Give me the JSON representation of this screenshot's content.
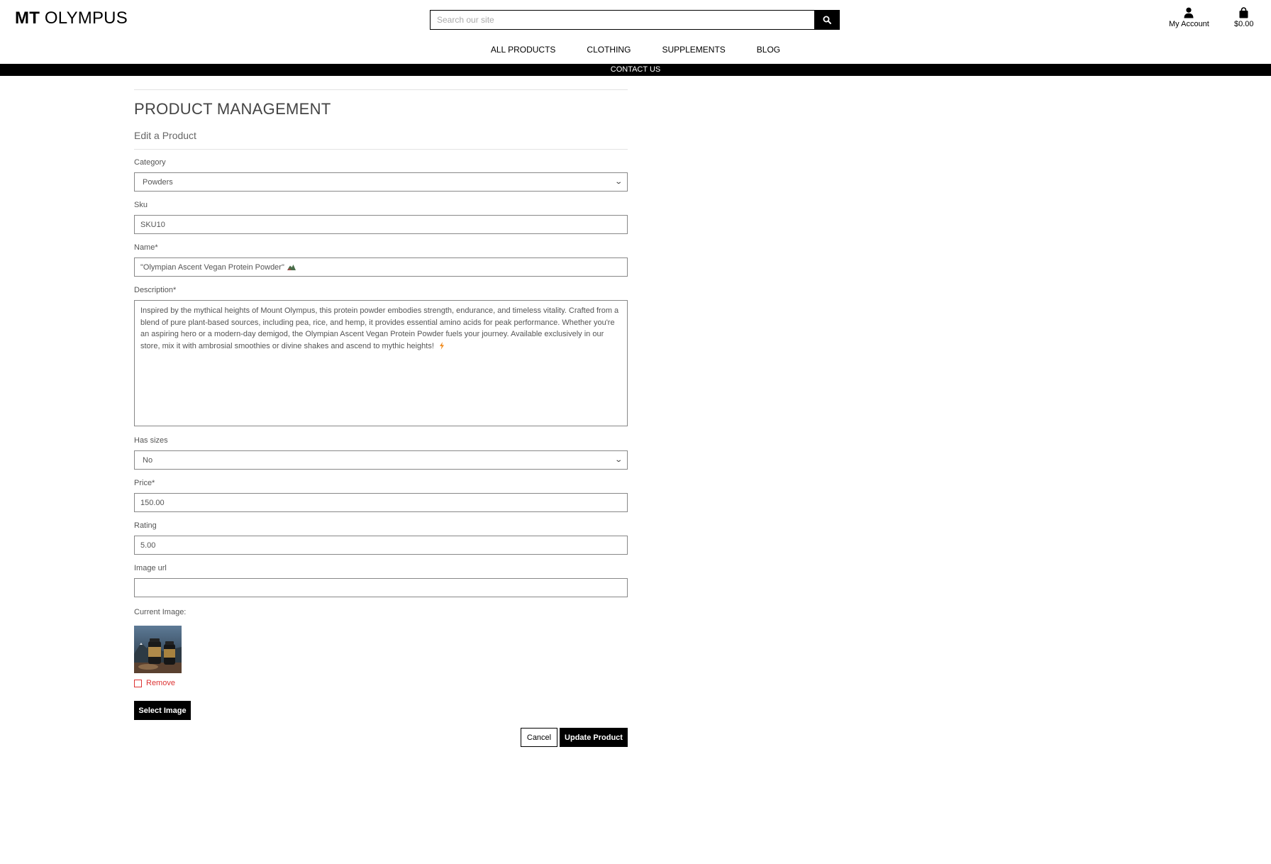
{
  "header": {
    "logo_bold": "MT",
    "logo_rest": " OLYMPUS",
    "search_placeholder": "Search our site",
    "account_label": "My Account",
    "bag_total": "$0.00"
  },
  "nav": {
    "items": [
      "ALL PRODUCTS",
      "CLOTHING",
      "SUPPLEMENTS",
      "BLOG"
    ],
    "contact": "CONTACT US"
  },
  "page": {
    "title": "PRODUCT MANAGEMENT",
    "subtitle": "Edit a Product"
  },
  "form": {
    "category": {
      "label": "Category",
      "value": "Powders"
    },
    "sku": {
      "label": "Sku",
      "value": "SKU10"
    },
    "name": {
      "label": "Name*",
      "value": "\"Olympian Ascent Vegan Protein Powder\""
    },
    "description": {
      "label": "Description*",
      "value": "Inspired by the mythical heights of Mount Olympus, this protein powder embodies strength, endurance, and timeless vitality. Crafted from a blend of pure plant-based sources, including pea, rice, and hemp, it provides essential amino acids for peak performance. Whether you're an aspiring hero or a modern-day demigod, the Olympian Ascent Vegan Protein Powder fuels your journey. Available exclusively in our store, mix it with ambrosial smoothies or divine shakes and ascend to mythic heights!"
    },
    "has_sizes": {
      "label": "Has sizes",
      "value": "No"
    },
    "price": {
      "label": "Price*",
      "value": "150.00"
    },
    "rating": {
      "label": "Rating",
      "value": "5.00"
    },
    "image_url": {
      "label": "Image url",
      "value": ""
    },
    "current_image_label": "Current Image:",
    "remove_label": "Remove",
    "select_image": "Select Image",
    "cancel": "Cancel",
    "update": "Update Product"
  },
  "colors": {
    "accent": "#000000",
    "remove_red": "#dd3333",
    "lightning": "#f08a1c"
  },
  "icons": [
    "search-icon",
    "user-icon",
    "shopping-bag-icon",
    "chevron-down-icon",
    "mountain-emoji-icon",
    "lightning-emoji-icon"
  ]
}
